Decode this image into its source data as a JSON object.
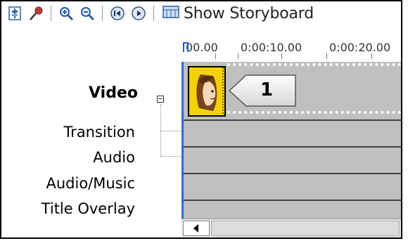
{
  "toolbar": {
    "storyboard_label": "Show Storyboard",
    "buttons": [
      {
        "name": "set-audio-levels-icon"
      },
      {
        "name": "narrate-timeline-icon"
      },
      {
        "name": "zoom-in-icon"
      },
      {
        "name": "zoom-out-icon"
      },
      {
        "name": "rewind-timeline-icon"
      },
      {
        "name": "play-timeline-icon"
      }
    ]
  },
  "ruler": {
    "ticks": [
      "00.00",
      "0:00:10.00",
      "0:00:20.00"
    ]
  },
  "tracks": {
    "video": "Video",
    "transition": "Transition",
    "audio": "Audio",
    "audio_music": "Audio/Music",
    "title_overlay": "Title Overlay"
  },
  "callout": {
    "number": "1"
  },
  "colors": {
    "track_bg": "#c0c0c0",
    "playhead": "#2b6fd0",
    "clip_bg": "#f3d20d"
  }
}
